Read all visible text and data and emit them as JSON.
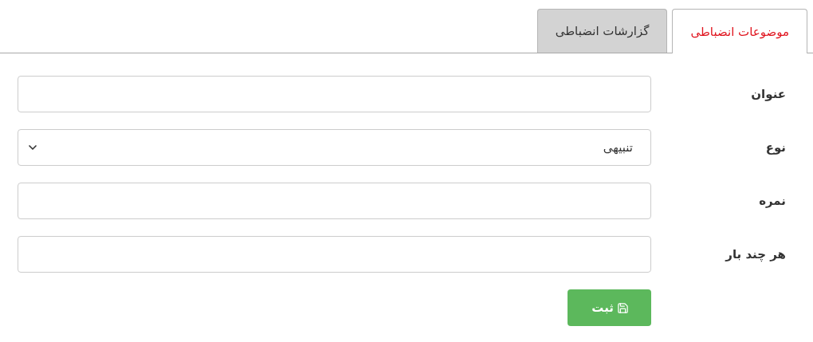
{
  "tabs": [
    {
      "label": "موضوعات انضباطی",
      "selected": true
    },
    {
      "label": "گزارشات انضباطی",
      "selected": false
    }
  ],
  "form": {
    "fields": [
      {
        "label": "عنوان",
        "kind": "text"
      },
      {
        "label": "نوع",
        "kind": "select",
        "value": "تنبیهی"
      },
      {
        "label": "نمره",
        "kind": "text"
      },
      {
        "label": "هر چند بار",
        "kind": "text"
      }
    ],
    "submit": "ثبت"
  }
}
